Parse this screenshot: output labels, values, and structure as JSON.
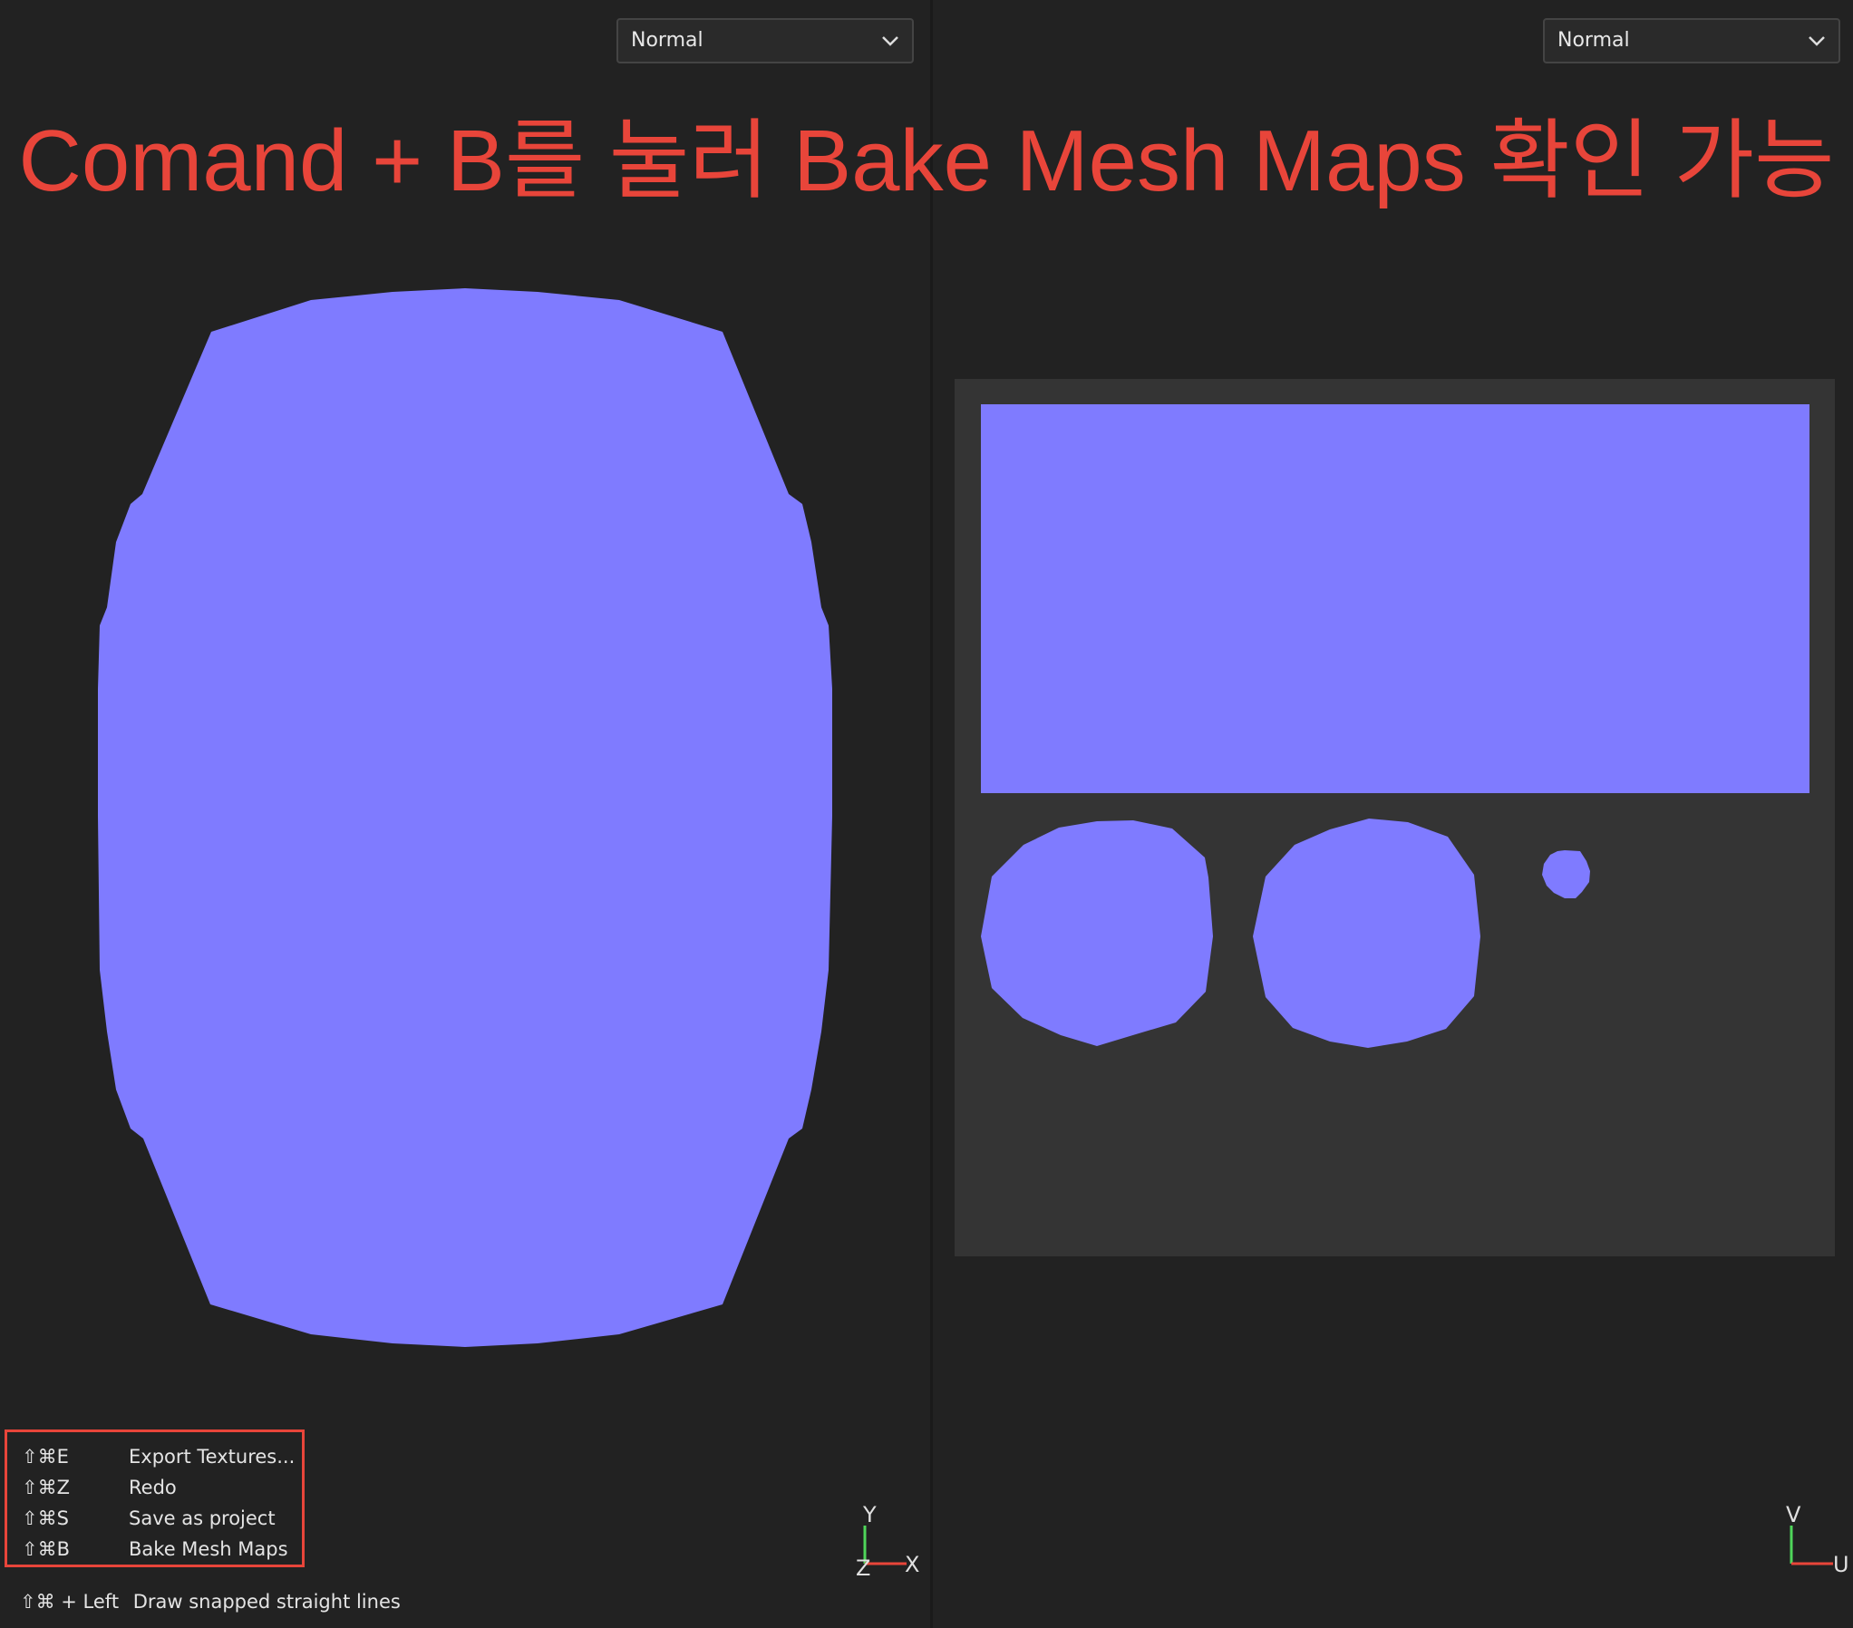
{
  "caption": "Comand + B를 눌러 Bake Mesh Maps 확인 가능",
  "left_viewport": {
    "channel_dropdown": {
      "value": "Normal",
      "icon": "chevron-down-icon"
    },
    "axis_gizmo": {
      "y": "Y",
      "x": "X",
      "z": "Z"
    }
  },
  "right_viewport": {
    "channel_dropdown": {
      "value": "Normal",
      "icon": "chevron-down-icon"
    },
    "axis_gizmo": {
      "v": "V",
      "u": "U"
    }
  },
  "shortcuts": [
    {
      "keys": "⇧⌘E",
      "label": "Export Textures..."
    },
    {
      "keys": "⇧⌘Z",
      "label": "Redo"
    },
    {
      "keys": "⇧⌘S",
      "label": "Save as project"
    },
    {
      "keys": "⇧⌘B",
      "label": "Bake Mesh Maps"
    }
  ],
  "hint": {
    "keys": "⇧⌘ + Left",
    "label": "Draw snapped straight lines"
  },
  "colors": {
    "normal_map": "#7f7bff",
    "background": "#222222",
    "uv_background": "#343434",
    "highlight": "#e8453a"
  }
}
